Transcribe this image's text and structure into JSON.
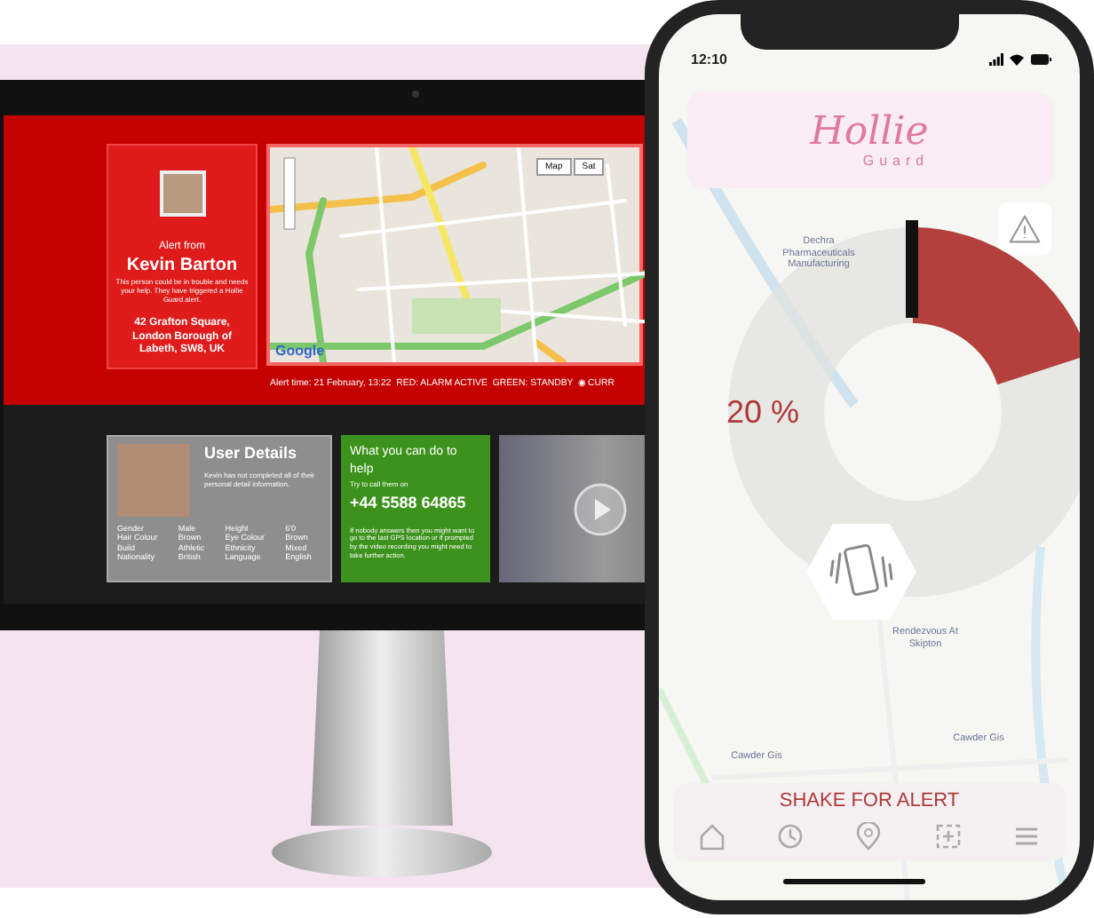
{
  "monitor": {
    "alert_card": {
      "heading": "Alert from",
      "name": "Kevin Barton",
      "message": "This person could be in trouble and needs your help. They have triggered a Hollie Guard alert.",
      "address": "42 Grafton Square, London Borough of Labeth, SW8, UK"
    },
    "map": {
      "buttons": [
        "Map",
        "Sat"
      ],
      "logo": "Google"
    },
    "status_line": "Alert time: 21 February, 13:22  RED: ALARM ACTIVE  GREEN: STANDBY  ◉ CURR",
    "user_details": {
      "title": "User Details",
      "note": "Kevin has not completed all of their personal detail information.",
      "fields": [
        {
          "label": "Gender",
          "value": "Male"
        },
        {
          "label": "Height",
          "value": "6'0"
        },
        {
          "label": "Hair Colour",
          "value": "Brown"
        },
        {
          "label": "Eye Colour",
          "value": "Brown"
        },
        {
          "label": "Build",
          "value": "Athletic"
        },
        {
          "label": "Ethnicity",
          "value": "Mixed"
        },
        {
          "label": "Nationality",
          "value": "British"
        },
        {
          "label": "Language",
          "value": "English"
        }
      ]
    },
    "help": {
      "title": "What you can do to help",
      "prompt": "Try to call them on",
      "phone": "+44 5588 64865",
      "advice": "If nobody answers then you might want to go to the last GPS location or if prompted by the video recording you might need to take further action."
    }
  },
  "phone": {
    "time": "12:10",
    "logo": "Hollie",
    "logo_sub": "Guard",
    "gauge": {
      "level": 0.2,
      "reading": "20 %"
    },
    "shake_label": "SHAKE FOR ALERT",
    "map_labels": [
      "Dechra Pharmaceuticals Manufacturing",
      "Rendezvous At Skipton",
      "Cawder Gis",
      "Cawder Gis"
    ]
  }
}
